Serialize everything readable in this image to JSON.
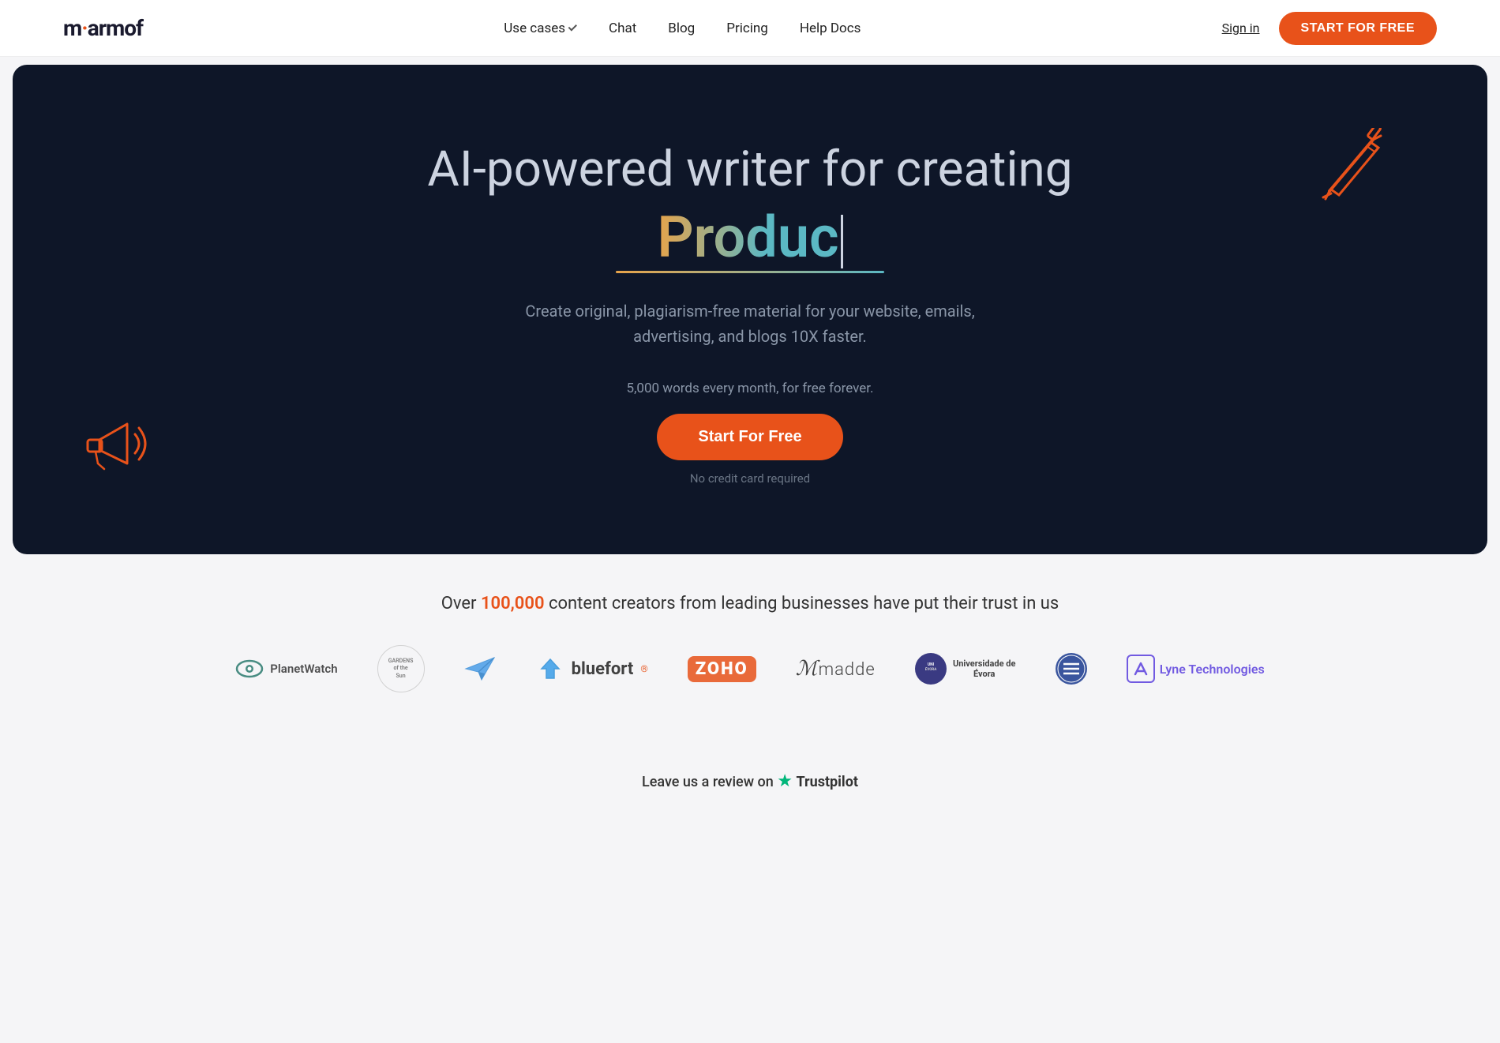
{
  "navbar": {
    "logo": "marmof",
    "nav_items": [
      {
        "id": "use-cases",
        "label": "Use cases",
        "has_dropdown": true
      },
      {
        "id": "chat",
        "label": "Chat"
      },
      {
        "id": "blog",
        "label": "Blog"
      },
      {
        "id": "pricing",
        "label": "Pricing"
      },
      {
        "id": "help-docs",
        "label": "Help Docs"
      }
    ],
    "sign_in_label": "Sign in",
    "start_free_label": "START FOR FREE"
  },
  "hero": {
    "title_line1": "AI-powered writer for creating",
    "animated_word": "Produc",
    "subtitle": "Create original, plagiarism-free material for your website, emails, advertising, and blogs 10X faster.",
    "words_note": "5,000 words every month, for free forever.",
    "cta_label": "Start For Free",
    "no_cc_label": "No credit card required"
  },
  "trust": {
    "heading_prefix": "Over ",
    "highlight_number": "100,000",
    "heading_suffix": " content creators from leading businesses have put their trust in us",
    "logos": [
      {
        "id": "planetwatch",
        "name": "PlanetWatch"
      },
      {
        "id": "gardens",
        "name": "Gardens of the Sun"
      },
      {
        "id": "paperplane",
        "name": ""
      },
      {
        "id": "bluefort",
        "name": "bluefort"
      },
      {
        "id": "zoho",
        "name": "ZOHO"
      },
      {
        "id": "madde",
        "name": "madde"
      },
      {
        "id": "universidade",
        "name": "Universidade de Évora"
      },
      {
        "id": "stripe",
        "name": ""
      },
      {
        "id": "lyne",
        "name": "Lyne Technologies"
      }
    ]
  },
  "trustpilot": {
    "label": "Leave us a review on",
    "name": "Trustpilot"
  }
}
